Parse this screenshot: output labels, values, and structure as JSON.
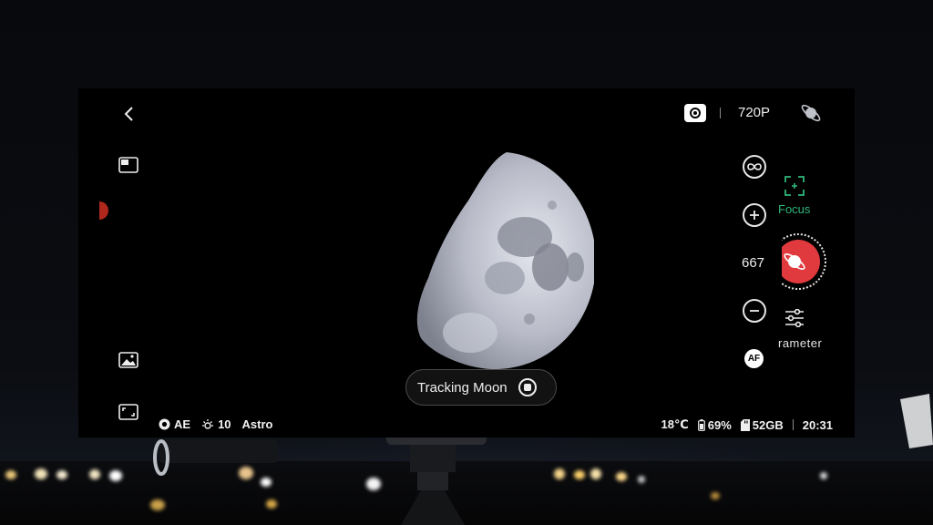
{
  "topbar": {
    "resolution": "720P"
  },
  "zoom": {
    "value": "667",
    "af_label": "AF"
  },
  "right_panel": {
    "focus_label": "Focus",
    "parameter_label": "rameter"
  },
  "tracking": {
    "label": "Tracking Moon"
  },
  "status_left": {
    "exposure_mode": "AE",
    "brightness": "10",
    "mode": "Astro"
  },
  "status_right": {
    "temperature": "18℃",
    "battery": "69%",
    "storage": "52GB",
    "time": "20:31"
  },
  "colors": {
    "accent_green": "#31b67a",
    "shutter_red": "#e03a3e",
    "screen_bg": "#000000"
  },
  "icons": {
    "back": "chevron-left-icon",
    "photo_mode": "camera-mode-icon",
    "target": "saturn-icon",
    "picture_in_picture": "pip-icon",
    "gallery": "image-icon",
    "fullscreen": "expand-icon",
    "infinity": "infinity-icon",
    "zoom_in": "plus-circle-icon",
    "zoom_out": "minus-circle-icon",
    "focus": "focus-frame-icon",
    "parameter": "sliders-icon"
  }
}
